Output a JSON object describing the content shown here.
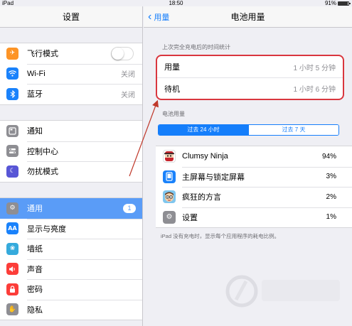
{
  "status_bar": {
    "device": "iPad",
    "time": "18:50",
    "battery": "91%",
    "battery_level": 0.91
  },
  "sidebar": {
    "title": "设置",
    "groups": [
      [
        {
          "label": "飞行模式",
          "icon": "airplane-icon",
          "icon_bg": "#fd9426",
          "control": "toggle",
          "value": ""
        },
        {
          "label": "Wi-Fi",
          "icon": "wifi-icon",
          "icon_bg": "#1a82fb",
          "value": "关闭"
        },
        {
          "label": "蓝牙",
          "icon": "bluetooth-icon",
          "icon_bg": "#1a82fb",
          "value": "关闭"
        }
      ],
      [
        {
          "label": "通知",
          "icon": "notifications-icon",
          "icon_bg": "#8e8e93"
        },
        {
          "label": "控制中心",
          "icon": "control-center-icon",
          "icon_bg": "#8e8e93"
        },
        {
          "label": "勿扰模式",
          "icon": "moon-icon",
          "icon_bg": "#5856d6"
        }
      ],
      [
        {
          "label": "通用",
          "icon": "gear-icon",
          "icon_bg": "#8e8e93",
          "badge": "1",
          "selected": true
        },
        {
          "label": "显示与亮度",
          "icon": "display-icon",
          "icon_bg": "#1a82fb",
          "icon_text": "AA"
        },
        {
          "label": "墙纸",
          "icon": "wallpaper-icon",
          "icon_bg": "#35aadc"
        },
        {
          "label": "声音",
          "icon": "speaker-icon",
          "icon_bg": "#fc3d39"
        },
        {
          "label": "密码",
          "icon": "lock-icon",
          "icon_bg": "#fc3d39"
        },
        {
          "label": "隐私",
          "icon": "hand-icon",
          "icon_bg": "#8e8e93"
        }
      ]
    ]
  },
  "detail": {
    "back_label": "用量",
    "title": "电池用量",
    "since_charge_header": "上次完全充电后的时间统计",
    "usage_rows": [
      {
        "label": "用量",
        "value": "1 小时 5 分钟"
      },
      {
        "label": "待机",
        "value": "1 小时 6 分钟"
      }
    ],
    "battery_usage_header": "电池用量",
    "segments": [
      {
        "label": "过去 24 小时",
        "active": true
      },
      {
        "label": "过去 7 天",
        "active": false
      }
    ],
    "apps": [
      {
        "name": "Clumsy Ninja",
        "percent": "94%",
        "icon": "ninja-icon",
        "icon_bg": "#ffffff"
      },
      {
        "name": "主屏幕与锁定屏幕",
        "percent": "3%",
        "icon": "home-screen-icon",
        "icon_bg": "#1a82fb"
      },
      {
        "name": "疯狂的方言",
        "percent": "2%",
        "icon": "crazy-face-icon",
        "icon_bg": "#7fc6ee"
      },
      {
        "name": "设置",
        "percent": "1%",
        "icon": "settings-gear-icon",
        "icon_bg": "#8e8e93"
      }
    ],
    "footnote": "iPad 没有充电时，显示每个应用程序的耗电比例。"
  },
  "colors": {
    "accent": "#157efb",
    "highlight": "#d9363e",
    "selected_row": "#5a9cf7"
  }
}
